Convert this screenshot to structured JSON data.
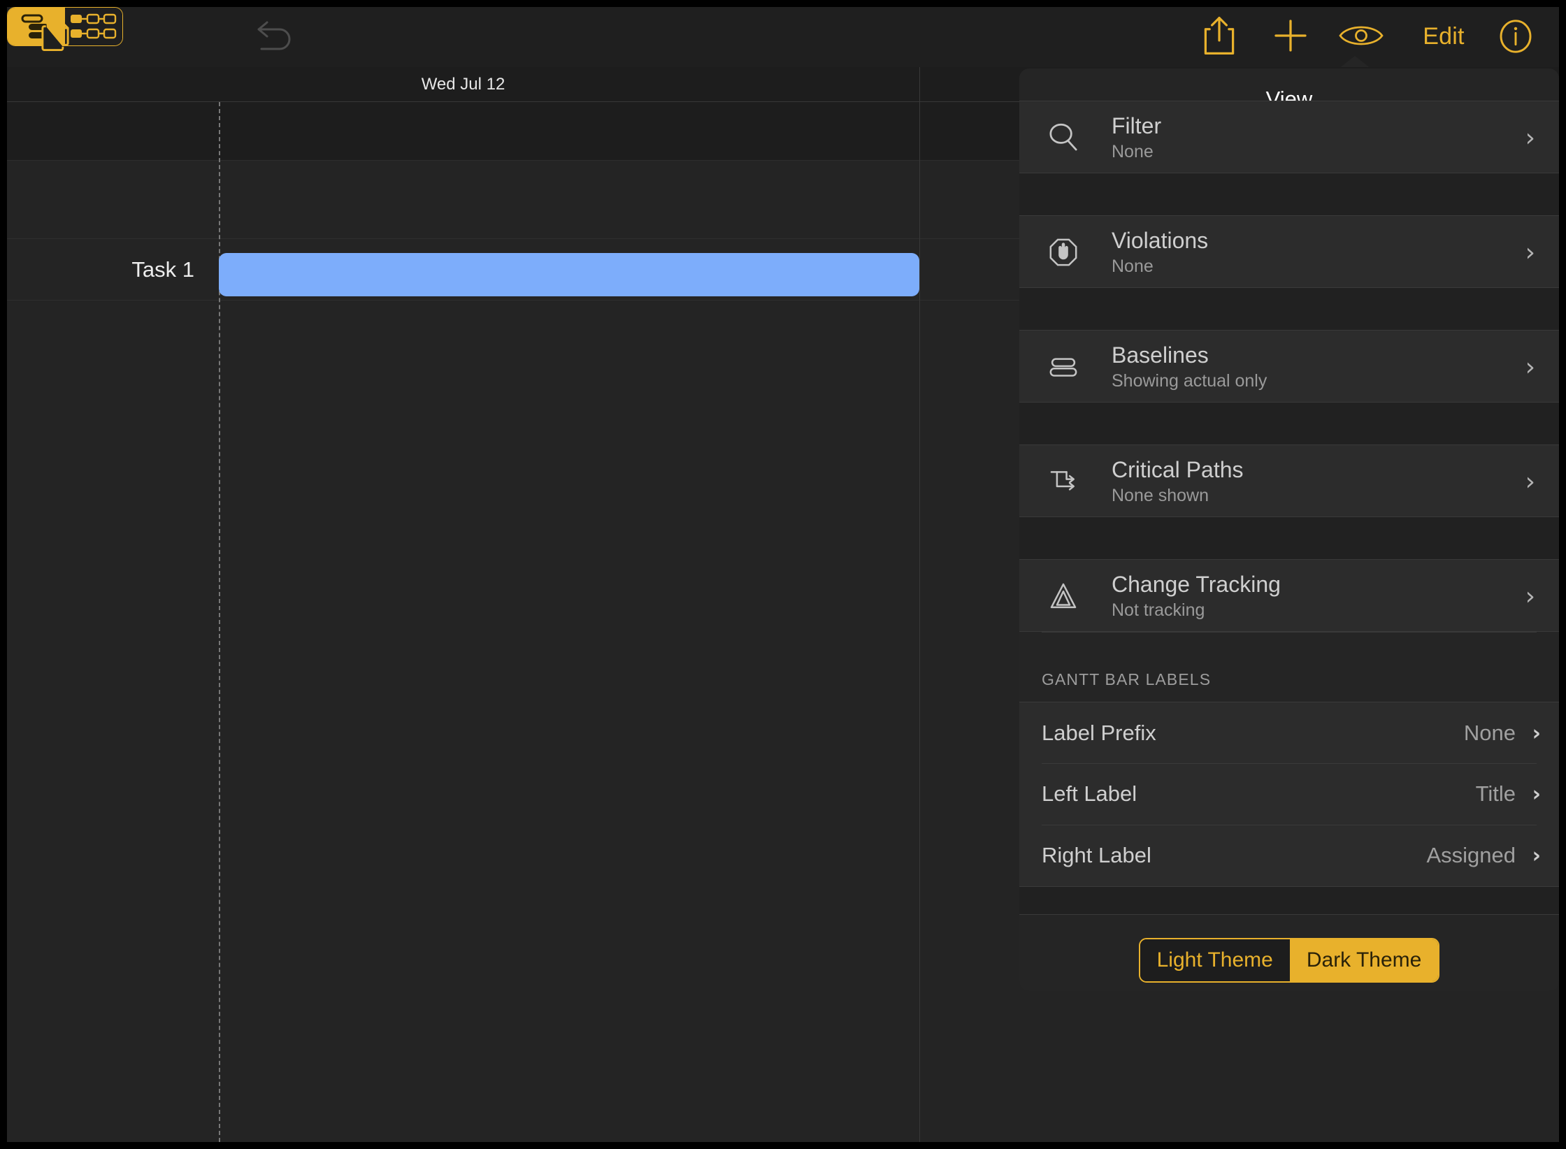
{
  "toolbar": {
    "documents_icon": "documents-icon",
    "view_mode": {
      "outline_icon": "task-outline-icon",
      "network_icon": "network-diagram-icon",
      "selected": "outline"
    },
    "undo_icon": "undo-arrow-icon",
    "undo_enabled": false,
    "share_icon": "share-icon",
    "add_icon": "plus-icon",
    "eye_icon": "eye-icon",
    "edit_label": "Edit",
    "info_icon": "info-circle-icon",
    "accent_color": "#e8b12c"
  },
  "gantt": {
    "date_header": "Wed Jul 12",
    "task_label": "Task 1",
    "bar_color": "#7dadfb"
  },
  "popover": {
    "title": "View",
    "rows": [
      {
        "icon": "search-icon",
        "title": "Filter",
        "sub": "None"
      },
      {
        "icon": "stop-hand-icon",
        "title": "Violations",
        "sub": "None"
      },
      {
        "icon": "baselines-icon",
        "title": "Baselines",
        "sub": "Showing actual only"
      },
      {
        "icon": "critical-path-icon",
        "title": "Critical Paths",
        "sub": "None shown"
      },
      {
        "icon": "delta-triangle-icon",
        "title": "Change Tracking",
        "sub": "Not tracking"
      }
    ],
    "section_header": "GANTT BAR LABELS",
    "label_rows": [
      {
        "name": "Label Prefix",
        "value": "None"
      },
      {
        "name": "Left Label",
        "value": "Title"
      },
      {
        "name": "Right Label",
        "value": "Assigned"
      }
    ],
    "theme": {
      "light_label": "Light Theme",
      "dark_label": "Dark Theme",
      "selected": "Dark Theme"
    },
    "chevron": "›"
  }
}
